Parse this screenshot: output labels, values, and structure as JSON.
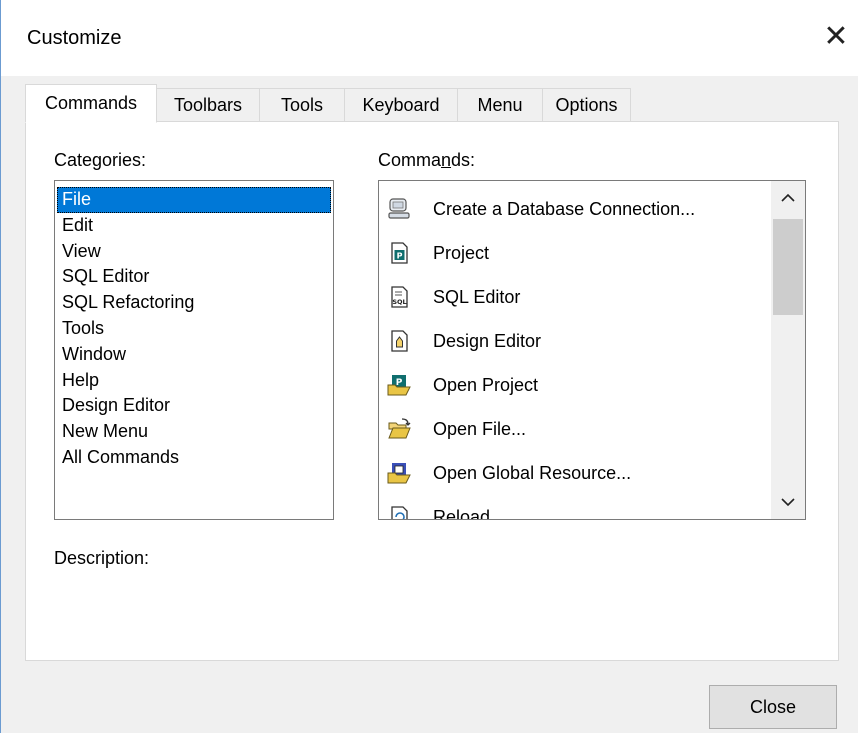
{
  "window": {
    "title": "Customize",
    "close_glyph": "✕"
  },
  "tabs": [
    {
      "label": "Commands",
      "active": true
    },
    {
      "label": "Toolbars",
      "active": false
    },
    {
      "label": "Tools",
      "active": false
    },
    {
      "label": "Keyboard",
      "active": false
    },
    {
      "label": "Menu",
      "active": false
    },
    {
      "label": "Options",
      "active": false
    }
  ],
  "categories": {
    "label_pre": "Cate",
    "label_u": "g",
    "label_post": "ories:",
    "selected": "File",
    "items": [
      "File",
      "Edit",
      "View",
      "SQL Editor",
      "SQL Refactoring",
      "Tools",
      "Window",
      "Help",
      "Design Editor",
      "New Menu",
      "All Commands"
    ]
  },
  "commands": {
    "label_pre": "Comma",
    "label_u": "n",
    "label_post": "ds:",
    "items": [
      {
        "label": "Create a Database Connection...",
        "icon": "database-connection-icon"
      },
      {
        "label": "Project",
        "icon": "project-icon"
      },
      {
        "label": "SQL Editor",
        "icon": "sql-editor-icon"
      },
      {
        "label": "Design Editor",
        "icon": "design-editor-icon"
      },
      {
        "label": "Open Project",
        "icon": "open-project-icon"
      },
      {
        "label": "Open File...",
        "icon": "open-file-icon"
      },
      {
        "label": "Open Global Resource...",
        "icon": "open-global-resource-icon"
      },
      {
        "label": "Reload",
        "icon": "reload-icon"
      }
    ]
  },
  "description": {
    "label": "Description:"
  },
  "footer": {
    "close_label": "Close"
  },
  "colors": {
    "selection": "#0078d7",
    "window_border": "#6b9bd1"
  }
}
